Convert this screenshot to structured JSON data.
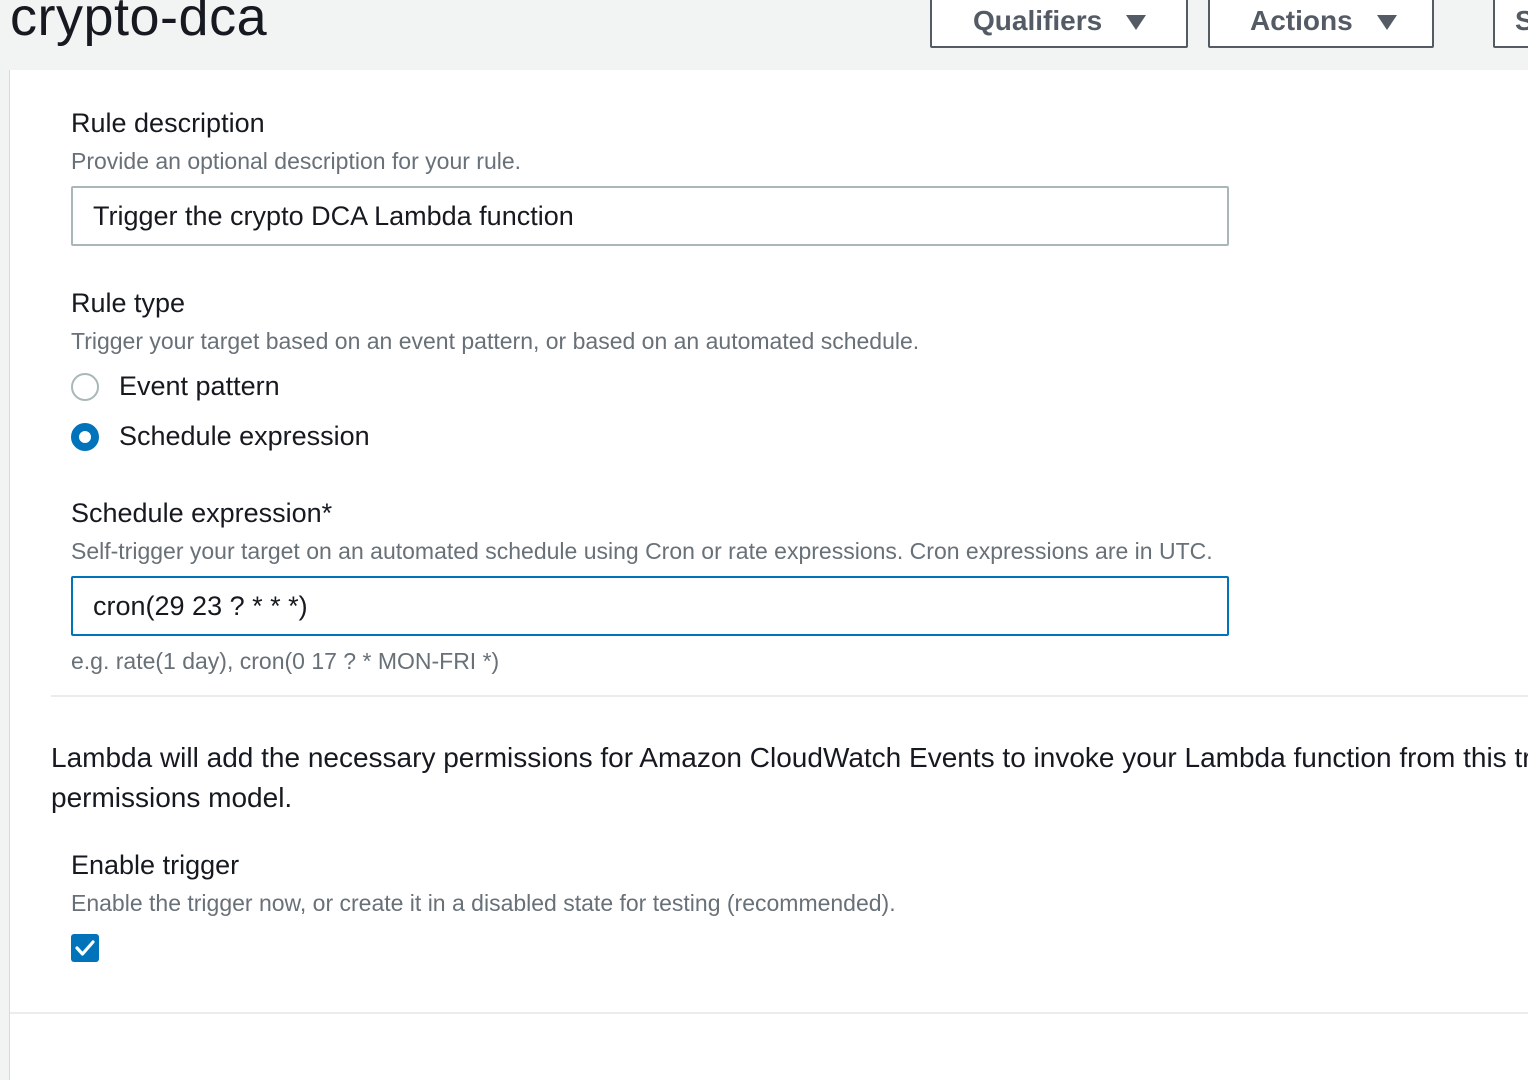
{
  "header": {
    "title": "crypto-dca",
    "qualifiers_label": "Qualifiers",
    "actions_label": "Actions",
    "save_label": "Save"
  },
  "rule_description": {
    "label": "Rule description",
    "help": "Provide an optional description for your rule.",
    "value": "Trigger the crypto DCA Lambda function"
  },
  "rule_type": {
    "label": "Rule type",
    "help": "Trigger your target based on an event pattern, or based on an automated schedule.",
    "options": [
      {
        "label": "Event pattern",
        "selected": false
      },
      {
        "label": "Schedule expression",
        "selected": true
      }
    ]
  },
  "schedule_expression": {
    "label": "Schedule expression*",
    "help": "Self-trigger your target on an automated schedule using Cron or rate expressions. Cron expressions are in UTC.",
    "value": "cron(29 23 ? * * *)",
    "hint": "e.g. rate(1 day), cron(0 17 ? * MON-FRI *)"
  },
  "permissions_note": {
    "line1": "Lambda will add the necessary permissions for Amazon CloudWatch Events to invoke your Lambda function from this trigger. Learn more about the Lambda",
    "line2": "permissions model."
  },
  "enable_trigger": {
    "label": "Enable trigger",
    "help": "Enable the trigger now, or create it in a disabled state for testing (recommended).",
    "checked": true
  },
  "colors": {
    "accent": "#0073bb",
    "label_text": "#16191f",
    "help_text": "#687078",
    "background": "#f2f3f3"
  }
}
